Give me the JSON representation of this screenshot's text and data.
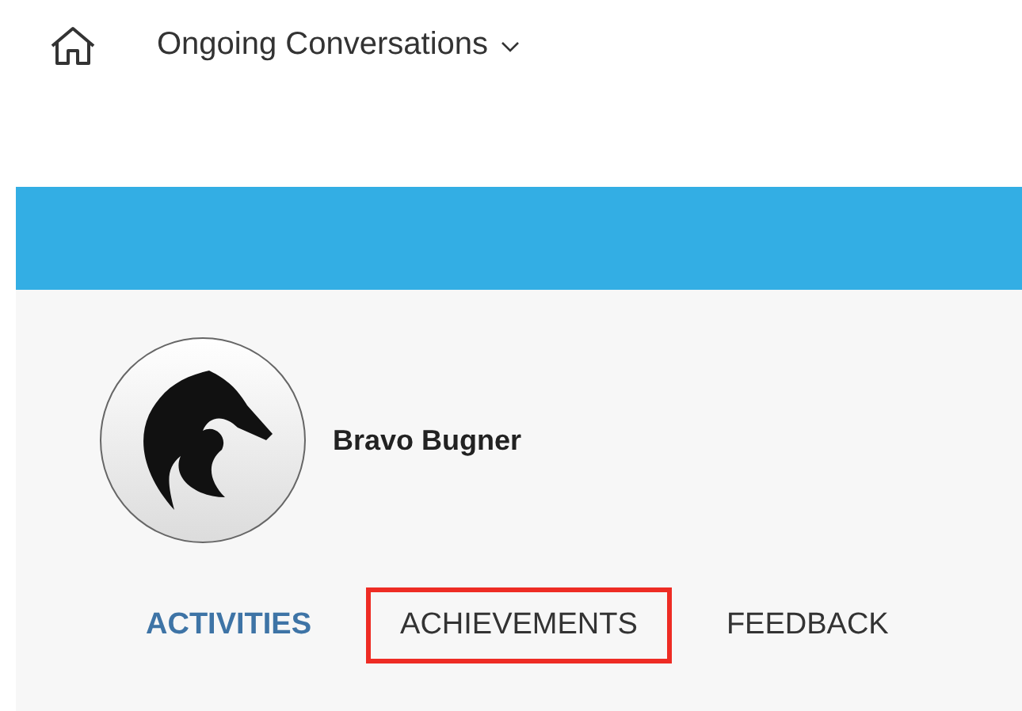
{
  "header": {
    "title": "Ongoing Conversations"
  },
  "profile": {
    "name": "Bravo Bugner"
  },
  "tabs": [
    {
      "label": "ACTIVITIES",
      "selected": true,
      "highlighted": false
    },
    {
      "label": "ACHIEVEMENTS",
      "selected": false,
      "highlighted": true
    },
    {
      "label": "FEEDBACK",
      "selected": false,
      "highlighted": false
    }
  ]
}
